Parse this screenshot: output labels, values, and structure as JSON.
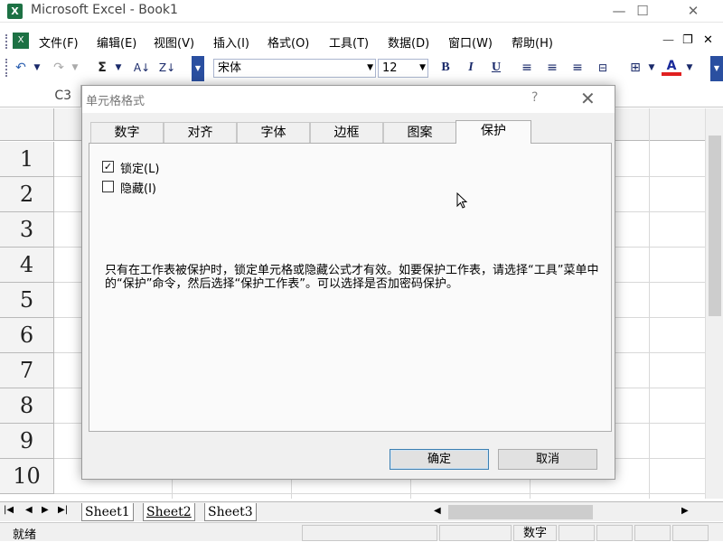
{
  "window": {
    "title": "Microsoft Excel - Book1",
    "app_icon": "excel-icon",
    "minimize": "—",
    "maximize": "☐",
    "close": "✕"
  },
  "menu": {
    "items": [
      "文件(F)",
      "编辑(E)",
      "视图(V)",
      "插入(I)",
      "格式(O)",
      "工具(T)",
      "数据(D)",
      "窗口(W)",
      "帮助(H)"
    ],
    "min": "—",
    "restore": "❐",
    "close": "✕"
  },
  "toolbar": {
    "undo": "↶",
    "redo": "↷",
    "sum": "Σ",
    "sort_asc": "A↓",
    "sort_desc": "Z↓",
    "font": "宋体",
    "size": "12",
    "bold": "B",
    "italic": "I",
    "underline": "U",
    "font_color": "A"
  },
  "formula": {
    "cell": "C3"
  },
  "rows": [
    "1",
    "2",
    "3",
    "4",
    "5",
    "6",
    "7",
    "8",
    "9",
    "10"
  ],
  "sheets": {
    "tabs": [
      "Sheet1",
      "Sheet2",
      "Sheet3"
    ]
  },
  "status": {
    "ready": "就绪",
    "num": "数字"
  },
  "dialog": {
    "title": "单元格格式",
    "help": "?",
    "close": "✕",
    "tabs": [
      "数字",
      "对齐",
      "字体",
      "边框",
      "图案",
      "保护"
    ],
    "active_tab": "保护",
    "locked_label": "锁定(L)",
    "locked_checked": true,
    "hidden_label": "隐藏(I)",
    "hidden_checked": false,
    "note": "只有在工作表被保护时，锁定单元格或隐藏公式才有效。如要保护工作表，请选择“工具”菜单中的“保护”命令，然后选择“保护工作表”。可以选择是否加密码保护。",
    "ok": "确定",
    "cancel": "取消"
  },
  "colors": {
    "excel_green": "#1d7144",
    "dialog_bg": "#f0f0f0",
    "default_button_border": "#3c7fb1"
  }
}
